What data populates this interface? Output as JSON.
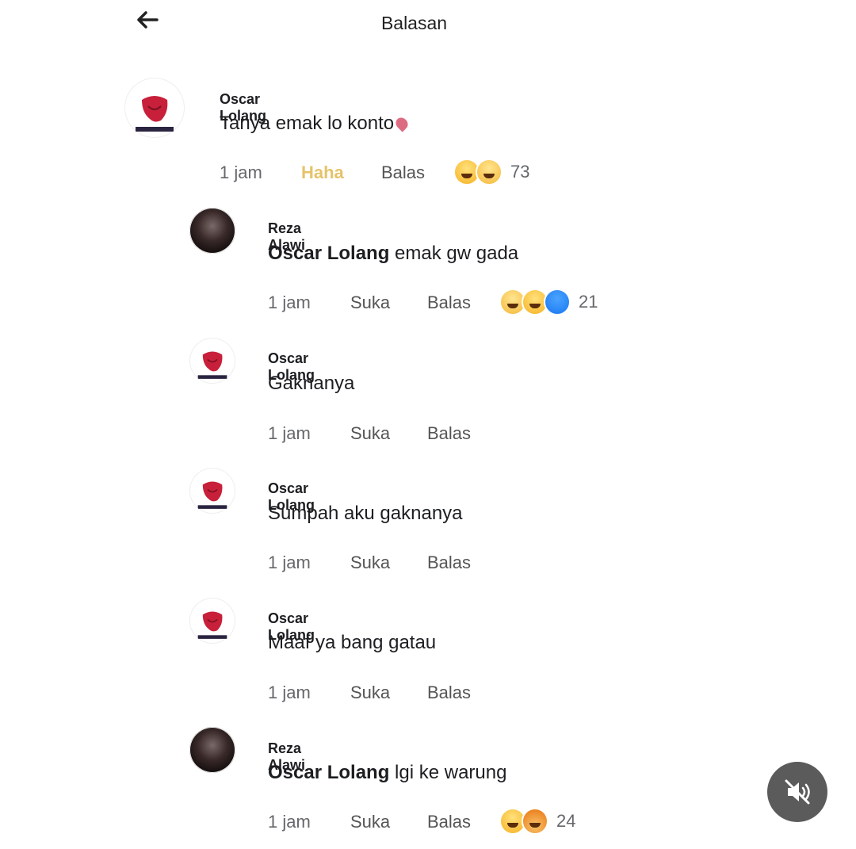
{
  "header": {
    "title": "Balasan"
  },
  "comments": [
    {
      "author": "Oscar Lolang",
      "mention": "",
      "text": "Tanya emak lo konto",
      "time": "1 jam",
      "like": "Haha",
      "reply": "Balas",
      "reaction_count": "73",
      "reactions": [
        "haha",
        "sad"
      ]
    },
    {
      "author": "Reza Alawi",
      "mention": "Oscar Lolang",
      "text": " emak gw gada",
      "time": "1 jam",
      "like": "Suka",
      "reply": "Balas",
      "reaction_count": "21",
      "reactions": [
        "sad",
        "haha",
        "like"
      ]
    },
    {
      "author": "Oscar Lolang",
      "mention": "",
      "text": "Gaknanya",
      "time": "1 jam",
      "like": "Suka",
      "reply": "Balas",
      "reaction_count": "",
      "reactions": []
    },
    {
      "author": "Oscar Lolang",
      "mention": "",
      "text": "Sumpah aku gaknanya",
      "time": "1 jam",
      "like": "Suka",
      "reply": "Balas",
      "reaction_count": "",
      "reactions": []
    },
    {
      "author": "Oscar Lolang",
      "mention": "",
      "text": "Maaf ya bang gatau",
      "time": "1 jam",
      "like": "Suka",
      "reply": "Balas",
      "reaction_count": "",
      "reactions": []
    },
    {
      "author": "Reza Alawi",
      "mention": "Oscar Lolang",
      "text": " lgi ke warung",
      "time": "1 jam",
      "like": "Suka",
      "reply": "Balas",
      "reaction_count": "24",
      "reactions": [
        "haha",
        "angry"
      ]
    }
  ],
  "icons": {
    "back": "arrow-left-icon",
    "mute": "speaker-muted-icon"
  }
}
